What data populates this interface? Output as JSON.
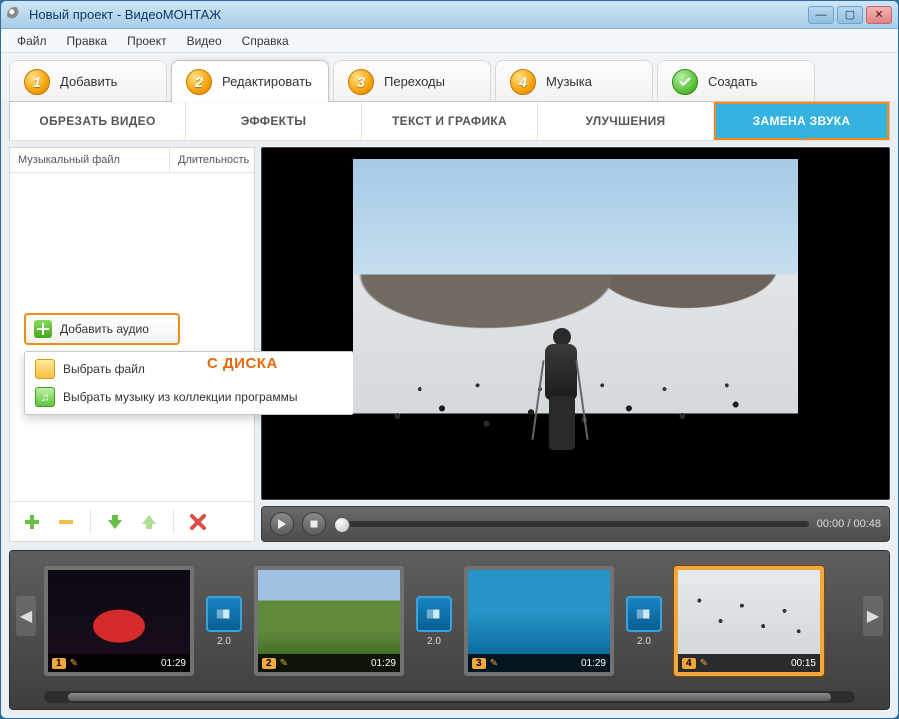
{
  "window": {
    "title": "Новый проект - ВидеоМОНТАЖ"
  },
  "menubar": [
    "Файл",
    "Правка",
    "Проект",
    "Видео",
    "Справка"
  ],
  "steps": [
    {
      "num": "1",
      "label": "Добавить"
    },
    {
      "num": "2",
      "label": "Редактировать"
    },
    {
      "num": "3",
      "label": "Переходы"
    },
    {
      "num": "4",
      "label": "Музыка"
    },
    {
      "num": "",
      "label": "Создать"
    }
  ],
  "subtabs": [
    "ОБРЕЗАТЬ ВИДЕО",
    "ЭФФЕКТЫ",
    "ТЕКСТ И ГРАФИКА",
    "УЛУЧШЕНИЯ",
    "ЗАМЕНА ЗВУКА"
  ],
  "audio_table": {
    "col_file": "Музыкальный файл",
    "col_dur": "Длительность"
  },
  "add_audio_button": "Добавить аудио",
  "dropdown": {
    "file": "Выбрать файл",
    "lib": "Выбрать музыку из коллекции программы",
    "annotation": "С ДИСКА"
  },
  "player_time": "00:00 / 00:48",
  "timeline": {
    "clips": [
      {
        "index": "1",
        "dur": "01:29"
      },
      {
        "index": "2",
        "dur": "01:29"
      },
      {
        "index": "3",
        "dur": "01:29"
      },
      {
        "index": "4",
        "dur": "00:15"
      }
    ],
    "transition_dur": "2.0"
  }
}
